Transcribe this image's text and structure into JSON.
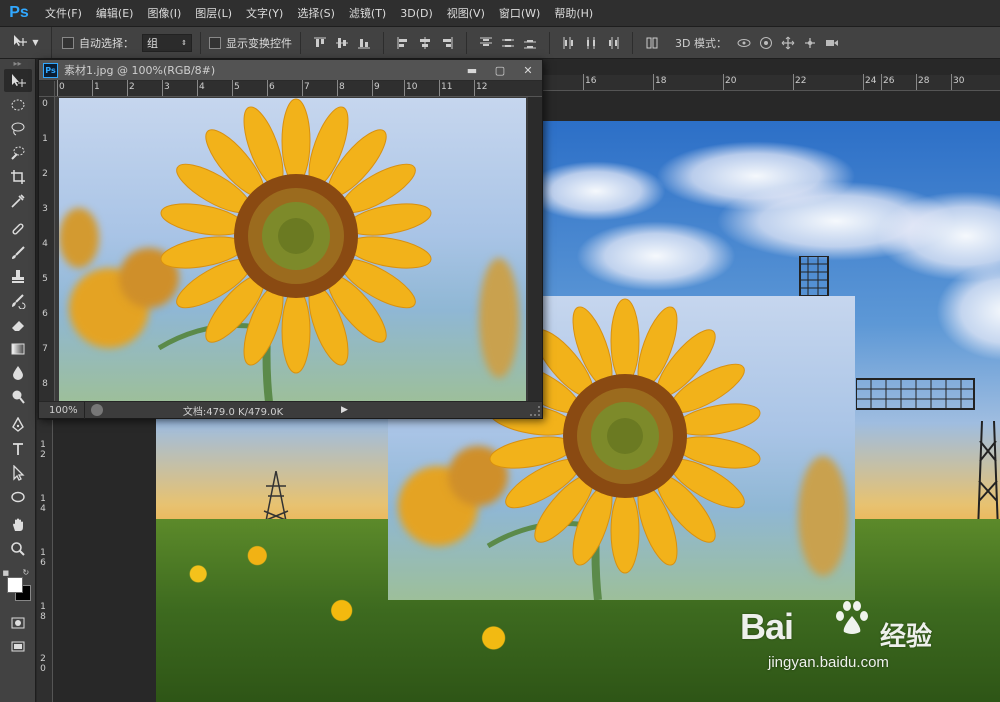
{
  "app": {
    "logo": "Ps"
  },
  "menu": [
    {
      "label": "文件(F)"
    },
    {
      "label": "编辑(E)"
    },
    {
      "label": "图像(I)"
    },
    {
      "label": "图层(L)"
    },
    {
      "label": "文字(Y)"
    },
    {
      "label": "选择(S)"
    },
    {
      "label": "滤镜(T)"
    },
    {
      "label": "3D(D)"
    },
    {
      "label": "视图(V)"
    },
    {
      "label": "窗口(W)"
    },
    {
      "label": "帮助(H)"
    }
  ],
  "options": {
    "auto_select_label": "自动选择：",
    "auto_select_value": "组",
    "show_transform_label": "显示变换控件",
    "mode_3d_label": "3D 模式："
  },
  "float_window": {
    "ps_badge": "Ps",
    "title": "素材1.jpg @ 100%(RGB/8#)",
    "zoom": "100%",
    "doc_info": "文档:479.0 K/479.0K",
    "ruler_top": [
      "0",
      "1",
      "2",
      "3",
      "4",
      "5",
      "6",
      "7",
      "8",
      "9",
      "10",
      "11",
      "12"
    ],
    "ruler_left": [
      "0",
      "1",
      "2",
      "3",
      "4",
      "5",
      "6",
      "7",
      "8"
    ]
  },
  "main_ruler_top": [
    "16",
    "18",
    "20",
    "22",
    "24",
    "26",
    "28",
    "30"
  ],
  "main_ruler_left": [
    "1",
    "2",
    "1",
    "4",
    "1",
    "6",
    "1",
    "8",
    "2",
    "0"
  ],
  "watermark": {
    "logo": "Bai",
    "logo_suffix": "经验",
    "url": "jingyan.baidu.com"
  },
  "colors": {
    "accent": "#31a8ff",
    "panel": "#424242",
    "canvas": "#282828"
  }
}
